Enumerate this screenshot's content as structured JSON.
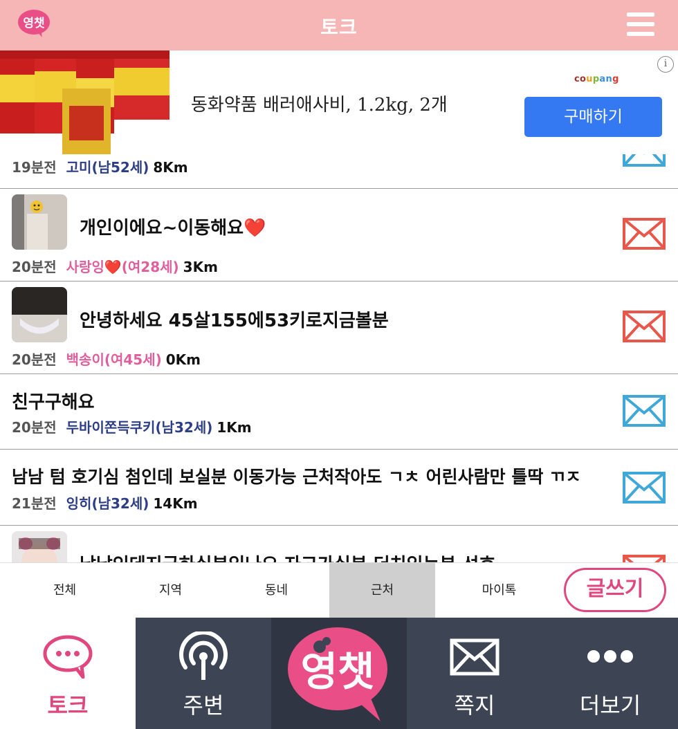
{
  "header": {
    "title": "토크",
    "logo_text": "영챗"
  },
  "ad": {
    "product_text": "동화약품 배러애사비, 1.2kg, 2개",
    "brand": "coupang",
    "buy_label": "구매하기",
    "info_symbol": "i"
  },
  "posts": [
    {
      "title": "",
      "time": "19분전",
      "nickname": "고미(남52세)",
      "gender": "male",
      "distance": "8Km",
      "has_thumb": false,
      "mail_color": "#40a8d8"
    },
    {
      "title": "개인이에요~이동해요❤️",
      "time": "20분전",
      "nickname": "사랑잉❤️(여28세)",
      "gender": "female",
      "distance": "3Km",
      "has_thumb": true,
      "mail_color": "#e8574a"
    },
    {
      "title": "안녕하세요 45살155에53키로지금볼분",
      "time": "20분전",
      "nickname": "백송이(여45세)",
      "gender": "female",
      "distance": "0Km",
      "has_thumb": true,
      "mail_color": "#e8574a"
    },
    {
      "title": "친구구해요",
      "time": "20분전",
      "nickname": "두바이쫀득쿠키(남32세)",
      "gender": "male",
      "distance": "1Km",
      "has_thumb": false,
      "mail_color": "#40a8d8"
    },
    {
      "title": "남남 텀 호기심 첨인데 보실분 이동가능 근처작아도 ㄱㅊ 어린사람만 틀딱 ㄲㅈ",
      "time": "21분전",
      "nickname": "잉히(남32세)",
      "gender": "male",
      "distance": "14Km",
      "has_thumb": false,
      "mail_color": "#40a8d8"
    },
    {
      "title": "남남인데지금하실분있나요 자고가실분 더치있는분 선호",
      "time": "",
      "nickname": "",
      "gender": "",
      "distance": "",
      "has_thumb": true,
      "mail_color": "#e8574a"
    }
  ],
  "tabs": [
    {
      "label": "전체",
      "active": false
    },
    {
      "label": "지역",
      "active": false
    },
    {
      "label": "동네",
      "active": false
    },
    {
      "label": "근처",
      "active": true
    },
    {
      "label": "마이톡",
      "active": false
    }
  ],
  "write_label": "글쓰기",
  "bottom_nav": [
    {
      "label": "토크",
      "icon": "chat-bubble-icon",
      "active": true
    },
    {
      "label": "주변",
      "icon": "broadcast-icon",
      "active": false
    },
    {
      "label": "영챗",
      "icon": "app-logo-icon",
      "active": false
    },
    {
      "label": "쪽지",
      "icon": "envelope-icon",
      "active": false
    },
    {
      "label": "더보기",
      "icon": "more-dots-icon",
      "active": false
    }
  ],
  "colors": {
    "header_bg": "#f7b6b6",
    "accent_pink": "#e0477f",
    "male_nick": "#2d3e86",
    "female_nick": "#de5f9c",
    "buy_button": "#3479f1",
    "nav_bg": "#3d4453"
  }
}
